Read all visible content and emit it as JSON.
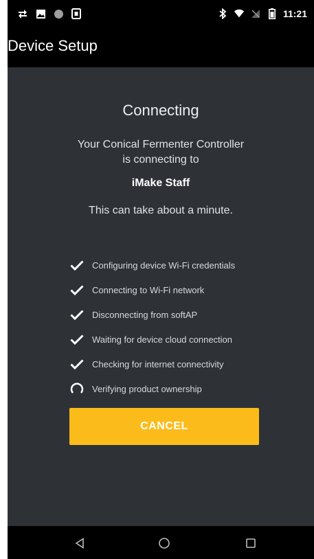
{
  "status_bar": {
    "time": "11:21",
    "left_icons": [
      "sync-icon",
      "image-icon",
      "circle-icon",
      "sim-icon"
    ],
    "right_icons": [
      "bluetooth-icon",
      "wifi-icon",
      "no-signal-icon",
      "battery-icon"
    ]
  },
  "app_bar": {
    "title": "Device Setup"
  },
  "main": {
    "heading": "Connecting",
    "message": "Your Conical Fermenter Controller is connecting to",
    "network_name": "iMake Staff",
    "time_note": "This can take about a minute.",
    "steps": [
      {
        "label": "Configuring device Wi-Fi credentials",
        "status": "done",
        "icon": "check-icon"
      },
      {
        "label": "Connecting to Wi-Fi network",
        "status": "done",
        "icon": "check-icon"
      },
      {
        "label": "Disconnecting from softAP",
        "status": "done",
        "icon": "check-icon"
      },
      {
        "label": "Waiting for device cloud connection",
        "status": "done",
        "icon": "check-icon"
      },
      {
        "label": "Checking for internet connectivity",
        "status": "done",
        "icon": "check-icon"
      },
      {
        "label": "Verifying product ownership",
        "status": "in-progress",
        "icon": "spinner-icon"
      }
    ],
    "cancel_label": "CANCEL"
  },
  "nav_bar": {
    "buttons": [
      "back-icon",
      "home-icon",
      "recents-icon"
    ]
  },
  "colors": {
    "background": "#2e3236",
    "bars": "#000000",
    "accent": "#fbbc1b",
    "text": "#ffffff"
  }
}
